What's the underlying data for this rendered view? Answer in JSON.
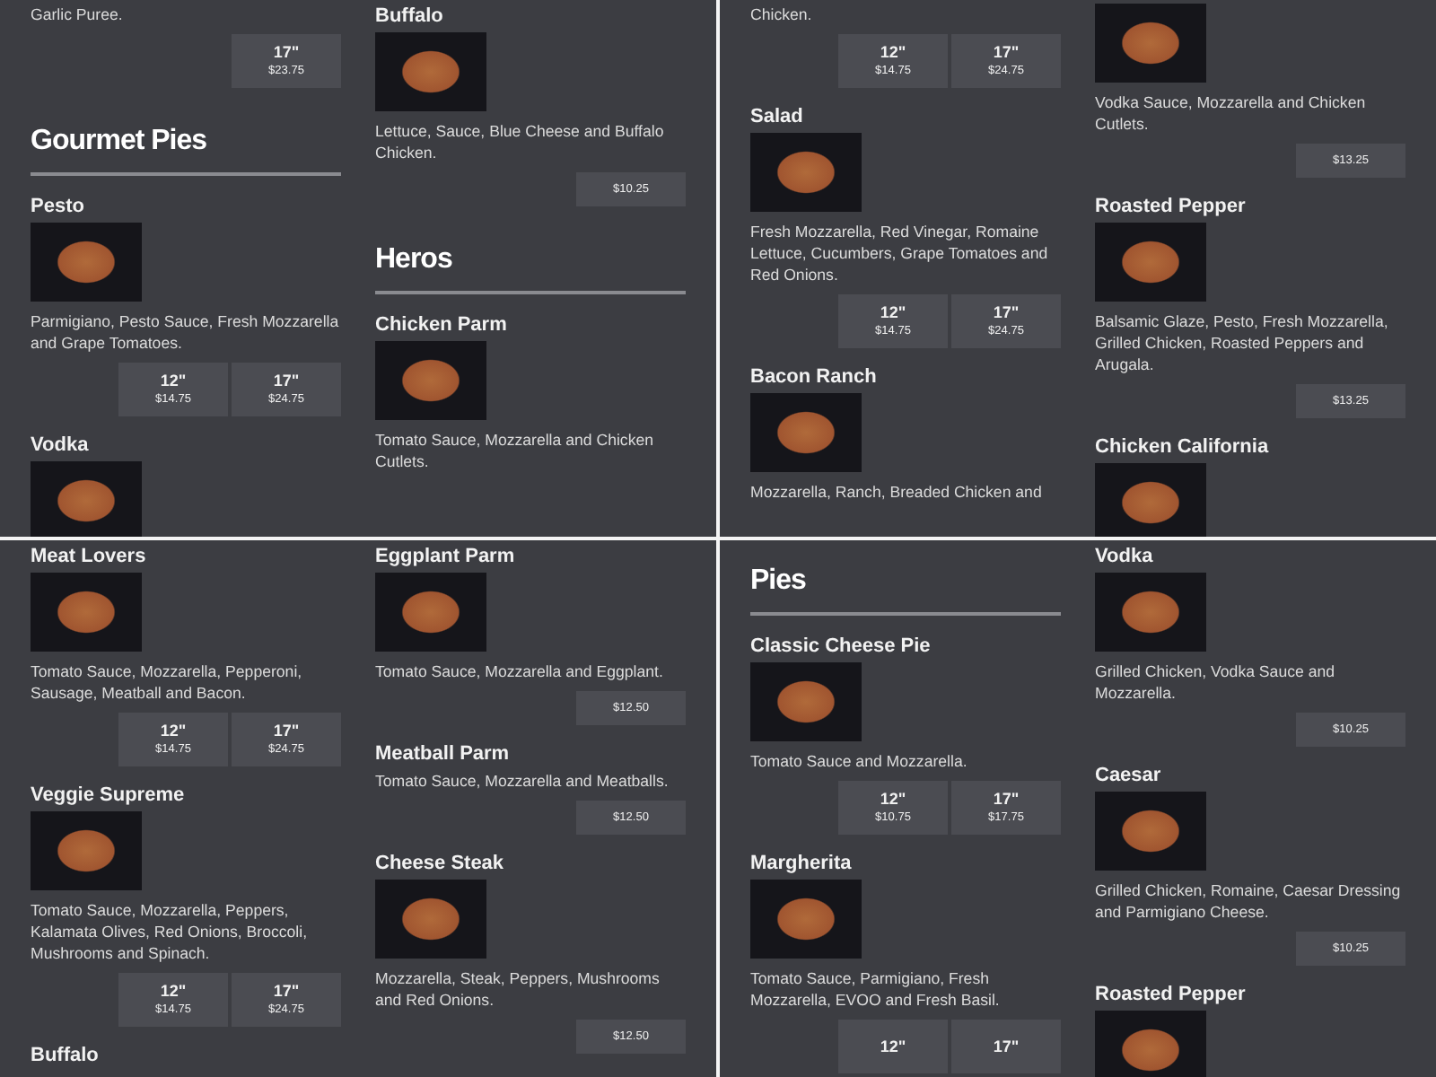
{
  "panels": [
    {
      "columns": [
        [
          {
            "kind": "desc",
            "text": "Garlic Puree."
          },
          {
            "kind": "prices",
            "prices": [
              {
                "size": "17\"",
                "price": "$23.75"
              }
            ]
          },
          {
            "kind": "heading",
            "text": "Gourmet Pies"
          },
          {
            "kind": "item",
            "name": "Pesto",
            "desc": "Parmigiano, Pesto Sauce, Fresh Mozzarella and Grape Tomatoes.",
            "prices": [
              {
                "size": "12\"",
                "price": "$14.75"
              },
              {
                "size": "17\"",
                "price": "$24.75"
              }
            ]
          },
          {
            "kind": "item",
            "name": "Vodka"
          }
        ],
        [
          {
            "kind": "item",
            "name": "Buffalo",
            "desc": "Lettuce, Sauce, Blue Cheese and Buffalo Chicken.",
            "prices": [
              {
                "price": "$10.25"
              }
            ]
          },
          {
            "kind": "heading",
            "text": "Heros"
          },
          {
            "kind": "item",
            "name": "Chicken Parm",
            "desc": "Tomato Sauce, Mozzarella and Chicken Cutlets."
          }
        ]
      ]
    },
    {
      "columns": [
        [
          {
            "kind": "desc",
            "text": "Chicken."
          },
          {
            "kind": "prices",
            "prices": [
              {
                "size": "12\"",
                "price": "$14.75"
              },
              {
                "size": "17\"",
                "price": "$24.75"
              }
            ]
          },
          {
            "kind": "item",
            "name": "Salad",
            "desc": "Fresh Mozzarella, Red Vinegar, Romaine Lettuce, Cucumbers, Grape Tomatoes and Red Onions.",
            "prices": [
              {
                "size": "12\"",
                "price": "$14.75"
              },
              {
                "size": "17\"",
                "price": "$24.75"
              }
            ]
          },
          {
            "kind": "item",
            "name": "Bacon Ranch",
            "desc": "Mozzarella, Ranch, Breaded Chicken and"
          }
        ],
        [
          {
            "kind": "photo"
          },
          {
            "kind": "desc",
            "text": "Vodka Sauce, Mozzarella and Chicken Cutlets."
          },
          {
            "kind": "prices",
            "prices": [
              {
                "price": "$13.25"
              }
            ]
          },
          {
            "kind": "item",
            "name": "Roasted Pepper",
            "desc": "Balsamic Glaze, Pesto, Fresh Mozzarella, Grilled Chicken, Roasted Peppers and Arugala.",
            "prices": [
              {
                "price": "$13.25"
              }
            ]
          },
          {
            "kind": "item",
            "name": "Chicken California"
          }
        ]
      ]
    },
    {
      "columns": [
        [
          {
            "kind": "item",
            "name": "Meat Lovers",
            "desc": "Tomato Sauce, Mozzarella, Pepperoni, Sausage, Meatball and Bacon.",
            "prices": [
              {
                "size": "12\"",
                "price": "$14.75"
              },
              {
                "size": "17\"",
                "price": "$24.75"
              }
            ]
          },
          {
            "kind": "item",
            "name": "Veggie Supreme",
            "desc": "Tomato Sauce, Mozzarella, Peppers, Kalamata Olives, Red Onions, Broccoli, Mushrooms and Spinach.",
            "prices": [
              {
                "size": "12\"",
                "price": "$14.75"
              },
              {
                "size": "17\"",
                "price": "$24.75"
              }
            ]
          },
          {
            "kind": "text_item",
            "name": "Buffalo"
          }
        ],
        [
          {
            "kind": "item",
            "name": "Eggplant Parm",
            "desc": "Tomato Sauce, Mozzarella and Eggplant.",
            "prices": [
              {
                "price": "$12.50"
              }
            ]
          },
          {
            "kind": "text_item",
            "name": "Meatball Parm",
            "desc": "Tomato Sauce, Mozzarella and Meatballs.",
            "prices": [
              {
                "price": "$12.50"
              }
            ]
          },
          {
            "kind": "item",
            "name": "Cheese Steak",
            "desc": "Mozzarella, Steak, Peppers, Mushrooms and Red Onions.",
            "prices": [
              {
                "price": "$12.50"
              }
            ]
          }
        ]
      ]
    },
    {
      "columns": [
        [
          {
            "kind": "heading",
            "text": "Pies"
          },
          {
            "kind": "item",
            "name": "Classic Cheese Pie",
            "desc": "Tomato Sauce and Mozzarella.",
            "prices": [
              {
                "size": "12\"",
                "price": "$10.75"
              },
              {
                "size": "17\"",
                "price": "$17.75"
              }
            ]
          },
          {
            "kind": "item",
            "name": "Margherita",
            "desc": "Tomato Sauce, Parmigiano, Fresh Mozzarella, EVOO and Fresh Basil.",
            "prices": [
              {
                "size": "12\""
              },
              {
                "size": "17\""
              }
            ]
          }
        ],
        [
          {
            "kind": "item",
            "name": "Vodka",
            "desc": "Grilled Chicken, Vodka Sauce and Mozzarella.",
            "prices": [
              {
                "price": "$10.25"
              }
            ]
          },
          {
            "kind": "item",
            "name": "Caesar",
            "desc": "Grilled Chicken, Romaine, Caesar Dressing and Parmigiano Cheese.",
            "prices": [
              {
                "price": "$10.25"
              }
            ]
          },
          {
            "kind": "item",
            "name": "Roasted Pepper"
          }
        ]
      ]
    }
  ]
}
